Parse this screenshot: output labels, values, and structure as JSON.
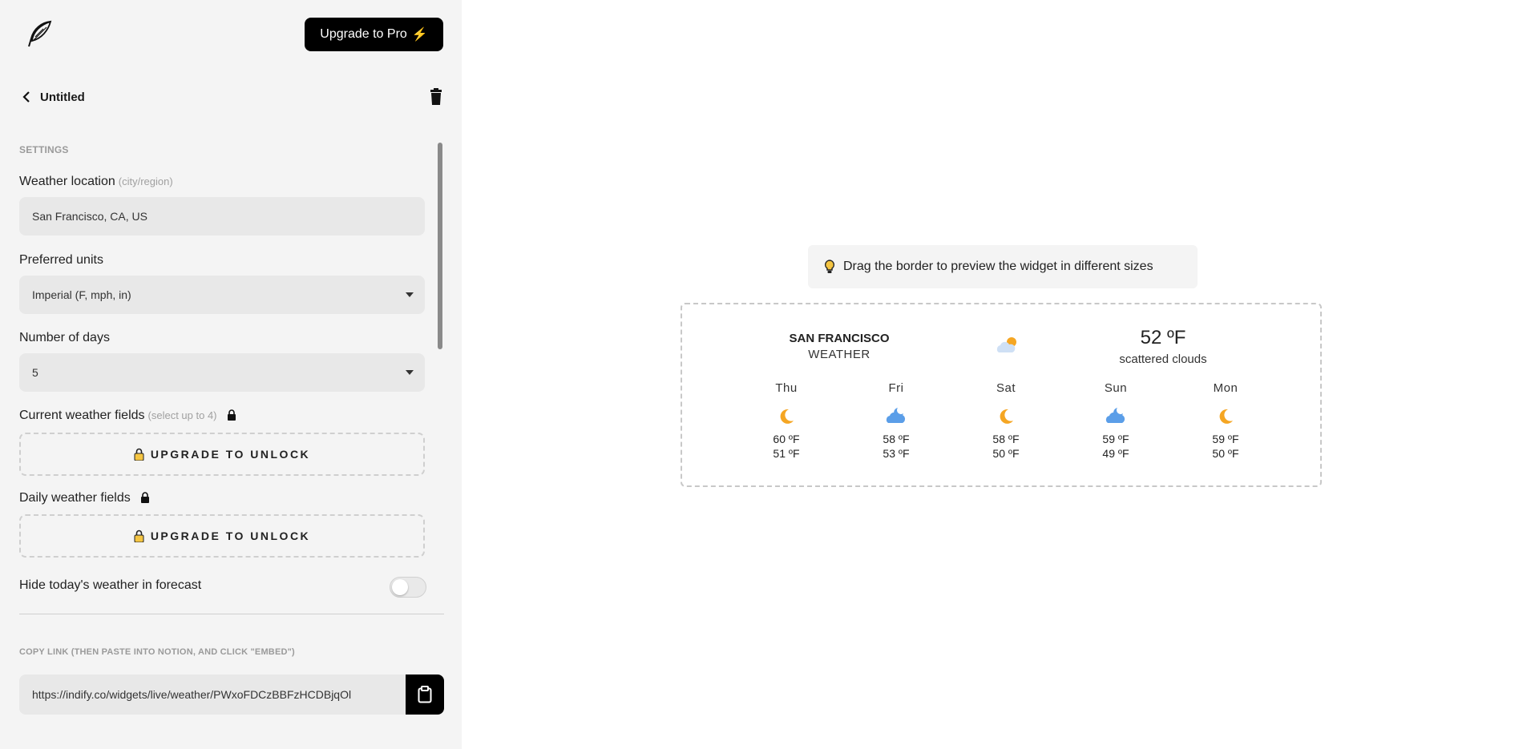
{
  "header": {
    "upgrade_label": "Upgrade to Pro",
    "title": "Untitled"
  },
  "settings": {
    "section_label": "SETTINGS",
    "location": {
      "label": "Weather location",
      "hint": "(city/region)",
      "value": "San Francisco, CA, US"
    },
    "units": {
      "label": "Preferred units",
      "value": "Imperial (F, mph, in)"
    },
    "days": {
      "label": "Number of days",
      "value": "5"
    },
    "current_fields": {
      "label": "Current weather fields",
      "hint": "(select up to 4)",
      "unlock_label": "UPGRADE TO UNLOCK"
    },
    "daily_fields": {
      "label": "Daily weather fields",
      "unlock_label": "UPGRADE TO UNLOCK"
    },
    "hide_today": {
      "label": "Hide today's weather in forecast",
      "enabled": false
    }
  },
  "copy_link": {
    "label": "COPY LINK (THEN PASTE INTO NOTION, AND CLICK \"EMBED\")",
    "url": "https://indify.co/widgets/live/weather/PWxoFDCzBBFzHCDBjqOl"
  },
  "preview": {
    "hint": "Drag the border to preview the widget in different sizes",
    "widget": {
      "city": "SAN FRANCISCO",
      "subtitle": "WEATHER",
      "current_icon": "cloud-sun-icon",
      "temp": "52 ºF",
      "description": "scattered clouds",
      "days": [
        {
          "name": "Thu",
          "icon": "moon-icon",
          "hi": "60 ºF",
          "lo": "51 ºF"
        },
        {
          "name": "Fri",
          "icon": "cloud-moon-icon",
          "hi": "58 ºF",
          "lo": "53 ºF"
        },
        {
          "name": "Sat",
          "icon": "moon-icon",
          "hi": "58 ºF",
          "lo": "50 ºF"
        },
        {
          "name": "Sun",
          "icon": "cloud-moon-icon",
          "hi": "59 ºF",
          "lo": "49 ºF"
        },
        {
          "name": "Mon",
          "icon": "moon-icon",
          "hi": "59 ºF",
          "lo": "50 ºF"
        }
      ]
    }
  },
  "colors": {
    "accent": "#000000",
    "sun": "#f5a623",
    "cloud": "#5b9ee8",
    "cloud_light": "#cfe0f5",
    "bolt": "#f5c542"
  }
}
